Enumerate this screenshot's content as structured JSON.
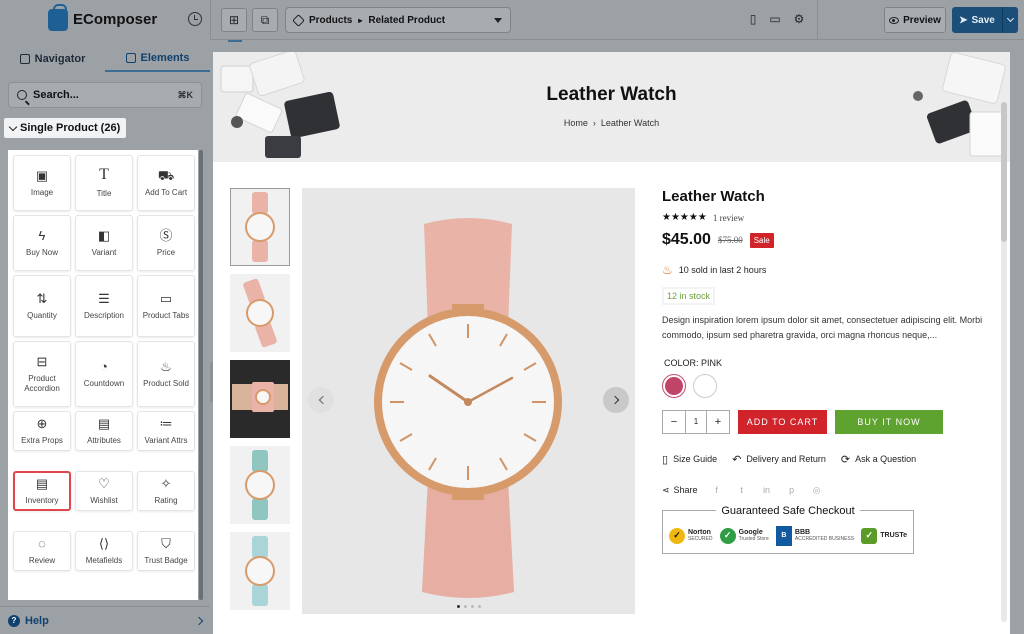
{
  "app": {
    "name": "EComposer"
  },
  "sidebar": {
    "tabs": [
      {
        "label": "Navigator",
        "icon": "layers-icon",
        "active": false
      },
      {
        "label": "Elements",
        "icon": "grid-icon",
        "active": true
      }
    ],
    "search": {
      "placeholder": "Search...",
      "shortcut": "⌘K"
    },
    "group": {
      "label": "Single Product (26)",
      "expanded": true
    },
    "elements": [
      {
        "label": "Image",
        "icon": "image-icon"
      },
      {
        "label": "Title",
        "icon": "text-icon"
      },
      {
        "label": "Add To Cart",
        "icon": "cart-icon"
      },
      {
        "label": "Buy Now",
        "icon": "bolt-icon"
      },
      {
        "label": "Variant",
        "icon": "variant-icon"
      },
      {
        "label": "Price",
        "icon": "dollar-icon"
      },
      {
        "label": "Quantity",
        "icon": "quantity-icon"
      },
      {
        "label": "Description",
        "icon": "document-icon"
      },
      {
        "label": "Product Tabs",
        "icon": "tabs-icon"
      },
      {
        "label": "Product Accordion",
        "icon": "accordion-icon"
      },
      {
        "label": "Countdown",
        "icon": "timer-icon"
      },
      {
        "label": "Product Sold",
        "icon": "flame-icon"
      },
      {
        "label": "Extra Props",
        "icon": "file-plus-icon"
      },
      {
        "label": "Attributes",
        "icon": "attributes-icon"
      },
      {
        "label": "Variant Attrs",
        "icon": "list-icon"
      },
      {
        "label": "Inventory",
        "icon": "archive-icon",
        "highlighted": true
      },
      {
        "label": "Wishlist",
        "icon": "heart-icon"
      },
      {
        "label": "Rating",
        "icon": "sparkle-icon"
      },
      {
        "label": "Review",
        "icon": "chat-icon"
      },
      {
        "label": "Metafields",
        "icon": "code-icon"
      },
      {
        "label": "Trust Badge",
        "icon": "shield-check-icon"
      }
    ],
    "help": {
      "label": "Help"
    }
  },
  "toolbar": {
    "page_selector": {
      "parent": "Products",
      "current": "Related Product"
    },
    "preview_label": "Preview",
    "save_label": "Save"
  },
  "page": {
    "hero": {
      "title": "Leather Watch",
      "breadcrumb_home": "Home",
      "breadcrumb_current": "Leather Watch"
    },
    "product": {
      "title": "Leather Watch",
      "stars": "★★★★★",
      "review_text": "1 review",
      "price": "$45.00",
      "compare_price": "$75.00",
      "sale_badge": "Sale",
      "sold_text": "10 sold in last 2 hours",
      "stock_text": "12 in stock",
      "description": "Design inspiration lorem ipsum dolor sit amet, consectetuer adipiscing elit. Morbi commodo, ipsum sed pharetra gravida, orci magna rhoncus neque,...",
      "color_label": "COLOR: PINK",
      "swatches": [
        {
          "name": "pink",
          "color": "#c04468",
          "selected": true
        },
        {
          "name": "white",
          "color": "#ffffff",
          "selected": false
        }
      ],
      "quantity": "1",
      "add_to_cart": "ADD TO CART",
      "buy_now": "BUY IT NOW",
      "links": [
        "Size Guide",
        "Delivery and Return",
        "Ask a Question"
      ],
      "share_label": "Share",
      "social_icons": [
        "facebook-icon",
        "twitter-icon",
        "linkedin-icon",
        "pinterest-icon",
        "reddit-icon"
      ],
      "checkout_title": "Guaranteed Safe Checkout",
      "trust_badges": [
        {
          "name": "Norton",
          "sub": "SECURED"
        },
        {
          "name": "Google",
          "sub": "Trusted Store"
        },
        {
          "name": "BBB",
          "sub": "ACCREDITED BUSINESS"
        },
        {
          "name": "TRUSTe",
          "sub": ""
        }
      ]
    },
    "gallery": {
      "slide_count": 4,
      "active_slide": 1
    }
  },
  "colors": {
    "brand": "#1b4f7a",
    "sale_red": "#d1232a",
    "buy_green": "#5ea22f",
    "stock_green": "#6ba33e",
    "highlight_red": "#e0464b",
    "watch_strap": "#e9b3a8",
    "watch_case": "#d79a6b"
  }
}
